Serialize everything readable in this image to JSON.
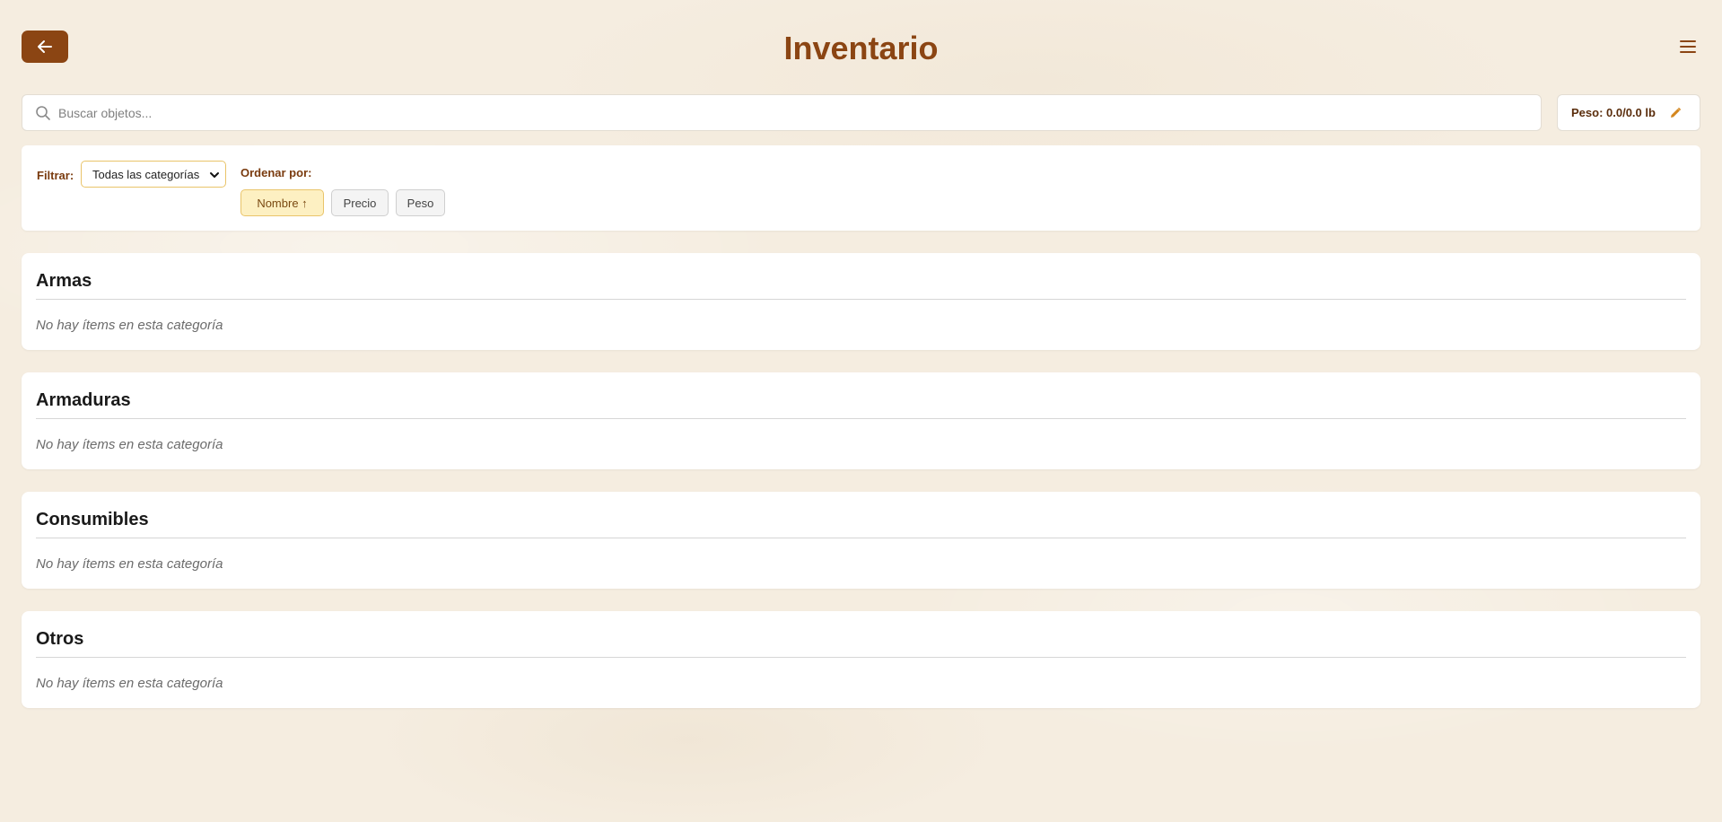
{
  "header": {
    "title": "Inventario",
    "back_icon": "arrow-left-icon",
    "menu_icon": "hamburger-menu-icon"
  },
  "search": {
    "placeholder": "Buscar objetos...",
    "value": "",
    "icon": "search-icon"
  },
  "weight": {
    "label": "Peso: 0.0/0.0 lb",
    "icon": "pencil-icon"
  },
  "filters": {
    "filter_label": "Filtrar:",
    "category_selected": "Todas las categorías",
    "order_label": "Ordenar por:",
    "sort_buttons": [
      {
        "label": "Nombre ↑",
        "active": true
      },
      {
        "label": "Precio",
        "active": false
      },
      {
        "label": "Peso",
        "active": false
      }
    ]
  },
  "categories": [
    {
      "title": "Armas",
      "empty_text": "No hay ítems en esta categoría"
    },
    {
      "title": "Armaduras",
      "empty_text": "No hay ítems en esta categoría"
    },
    {
      "title": "Consumibles",
      "empty_text": "No hay ítems en esta categoría"
    },
    {
      "title": "Otros",
      "empty_text": "No hay ítems en esta categoría"
    }
  ],
  "colors": {
    "accent": "#8b4513",
    "background": "#f5ede0",
    "active_sort_bg": "#fdf0c2",
    "active_sort_border": "#e9c46a"
  }
}
